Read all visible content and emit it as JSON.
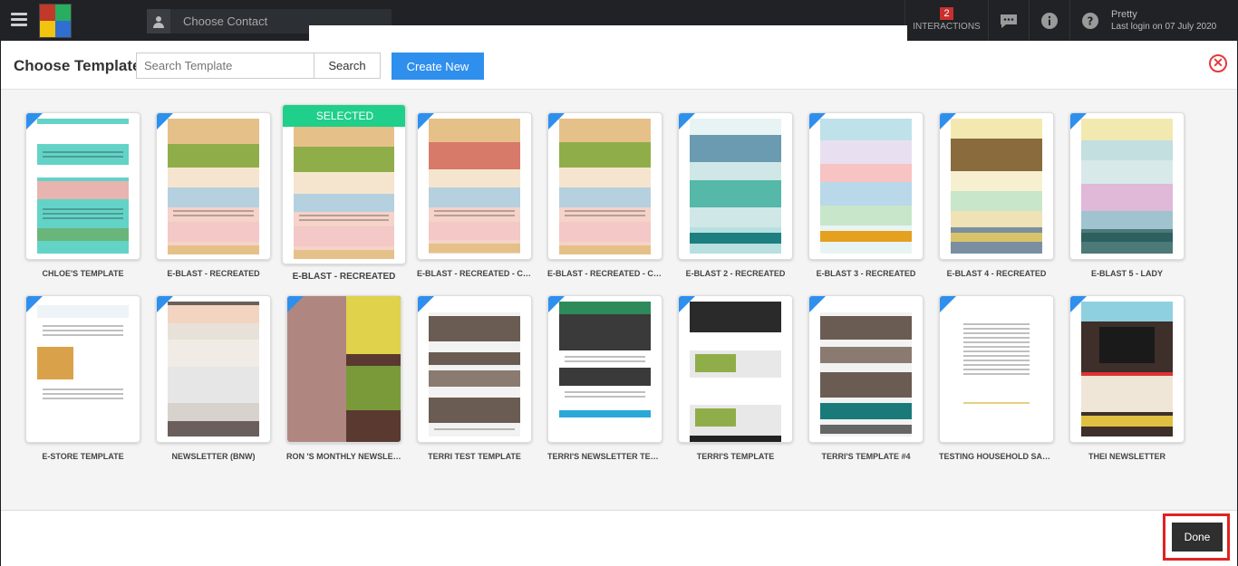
{
  "topbar": {
    "contact_placeholder": "Choose Contact",
    "interactions_count": "2",
    "interactions_label": "INTERACTIONS",
    "user_name": "Pretty",
    "last_login": "Last login on 07 July 2020"
  },
  "modal": {
    "title": "Choose Template",
    "search_placeholder": "Search Template",
    "search_button": "Search",
    "create_button": "Create New",
    "done_button": "Done",
    "selected_label": "SELECTED"
  },
  "templates_row1": [
    {
      "name": "CHLOE'S TEMPLATE"
    },
    {
      "name": "E-BLAST - RECREATED"
    },
    {
      "name": "E-BLAST - RECREATED"
    },
    {
      "name": "E-BLAST - RECREATED - COPI..."
    },
    {
      "name": "E-BLAST - RECREATED - COPY"
    },
    {
      "name": "E-BLAST 2 - RECREATED"
    },
    {
      "name": "E-BLAST 3 - RECREATED"
    },
    {
      "name": "E-BLAST 4 - RECREATED"
    },
    {
      "name": "E-BLAST 5 - LADY"
    }
  ],
  "templates_row2": [
    {
      "name": "E-STORE TEMPLATE"
    },
    {
      "name": "NEWSLETTER (BNW)"
    },
    {
      "name": "RON 'S MONTHLY NEWSLET..."
    },
    {
      "name": "TERRI TEST TEMPLATE"
    },
    {
      "name": "TERRI'S NEWSLETTER TEMPL..."
    },
    {
      "name": "TERRI'S TEMPLATE"
    },
    {
      "name": "TERRI'S TEMPLATE #4"
    },
    {
      "name": "TESTING HOUSEHOLD SALU..."
    },
    {
      "name": "THEI NEWSLETTER"
    }
  ]
}
